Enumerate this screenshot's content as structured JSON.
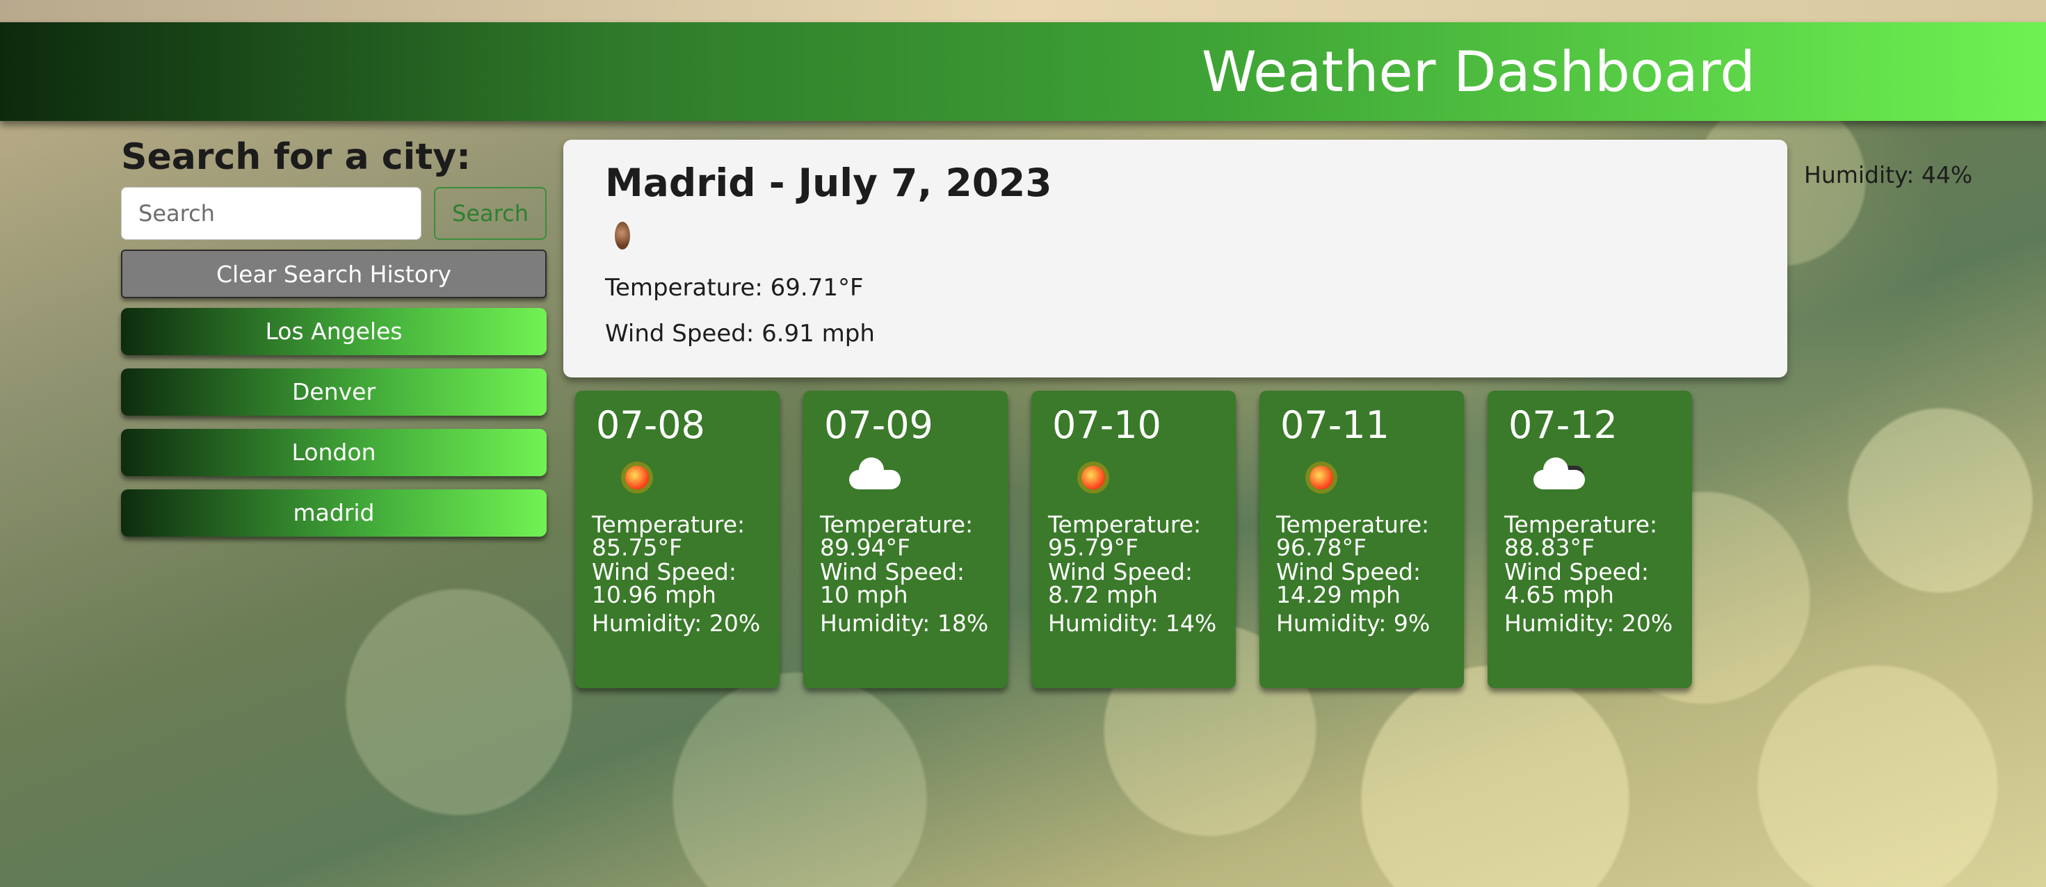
{
  "header": {
    "title": "Weather Dashboard"
  },
  "sidebar": {
    "heading": "Search for a city:",
    "search_placeholder": "Search",
    "search_button": "Search",
    "clear_button": "Clear Search History",
    "history": [
      "Los Angeles",
      "Denver",
      "London",
      "madrid"
    ]
  },
  "current": {
    "title": "Madrid - July 7, 2023",
    "icon": "haze-icon",
    "temperature": "Temperature: 69.71°F",
    "wind": "Wind Speed: 6.91 mph",
    "humidity": "Humidity: 44%"
  },
  "forecast": [
    {
      "date": "07-08",
      "icon": "sun-icon",
      "temp_label": "Temperature:",
      "temp": "85.75°F",
      "wind_label": "Wind Speed:",
      "wind": "10.96 mph",
      "humidity": "Humidity: 20%"
    },
    {
      "date": "07-09",
      "icon": "cloud-icon",
      "temp_label": "Temperature:",
      "temp": "89.94°F",
      "wind_label": "Wind Speed:",
      "wind": "10 mph",
      "humidity": "Humidity: 18%"
    },
    {
      "date": "07-10",
      "icon": "sun-icon",
      "temp_label": "Temperature:",
      "temp": "95.79°F",
      "wind_label": "Wind Speed:",
      "wind": "8.72 mph",
      "humidity": "Humidity: 14%"
    },
    {
      "date": "07-11",
      "icon": "sun-icon",
      "temp_label": "Temperature:",
      "temp": "96.78°F",
      "wind_label": "Wind Speed:",
      "wind": "14.29 mph",
      "humidity": "Humidity: 9%"
    },
    {
      "date": "07-12",
      "icon": "partly-cloudy-icon",
      "temp_label": "Temperature:",
      "temp": "88.83°F",
      "wind_label": "Wind Speed:",
      "wind": "4.65 mph",
      "humidity": "Humidity: 20%"
    }
  ],
  "colors": {
    "header_start": "#0d2a0d",
    "header_end": "#6ef252",
    "forecast_card": "#3a7a2a",
    "clear_button": "#7d7d7d"
  }
}
